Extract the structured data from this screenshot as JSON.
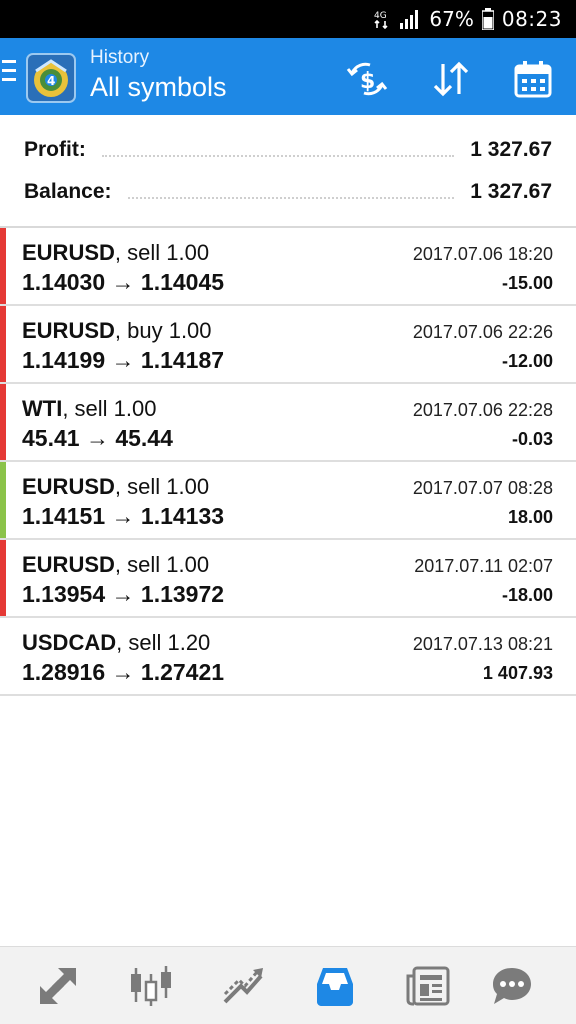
{
  "status_bar": {
    "network": "4G",
    "battery": "67%",
    "time": "08:23"
  },
  "app_bar": {
    "subtitle": "History",
    "title": "All symbols",
    "icons": [
      "menu-icon",
      "app-logo",
      "deposit-withdraw-icon",
      "sort-icon",
      "calendar-icon"
    ]
  },
  "summary": {
    "profit_label": "Profit:",
    "profit_value": "1 327.67",
    "balance_label": "Balance:",
    "balance_value": "1 327.67"
  },
  "deals": [
    {
      "symbol": "EURUSD",
      "action": ", sell 1.00",
      "prices": "1.14030 → 1.14045",
      "time": "2017.07.06 18:20",
      "profit": "-15.00",
      "bar_color": "#e53935"
    },
    {
      "symbol": "EURUSD",
      "action": ", buy 1.00",
      "prices": "1.14199 → 1.14187",
      "time": "2017.07.06 22:26",
      "profit": "-12.00",
      "bar_color": "#e53935"
    },
    {
      "symbol": "WTI",
      "action": ", sell 1.00",
      "prices": "45.41 → 45.44",
      "time": "2017.07.06 22:28",
      "profit": "-0.03",
      "bar_color": "#e53935"
    },
    {
      "symbol": "EURUSD",
      "action": ", sell 1.00",
      "prices": "1.14151 → 1.14133",
      "time": "2017.07.07 08:28",
      "profit": "18.00",
      "bar_color": "#8bc34a"
    },
    {
      "symbol": "EURUSD",
      "action": ", sell 1.00",
      "prices": "1.13954 → 1.13972",
      "time": "2017.07.11 02:07",
      "profit": "-18.00",
      "bar_color": "#e53935"
    },
    {
      "symbol": "USDCAD",
      "action": ", sell 1.20",
      "prices": "1.28916 → 1.27421",
      "time": "2017.07.13 08:21",
      "profit": "1 407.93",
      "bar_color": ""
    }
  ],
  "bottom_nav": {
    "items": [
      "quotes-icon",
      "chart-icon",
      "trade-icon",
      "history-icon",
      "news-icon",
      "chat-icon"
    ],
    "active": "history-icon",
    "active_color": "#1e88e5",
    "inactive_color": "#7b7b7b"
  },
  "colors": {
    "appbar": "#1e88e5",
    "loss": "#e53935",
    "gain": "#8bc34a"
  }
}
